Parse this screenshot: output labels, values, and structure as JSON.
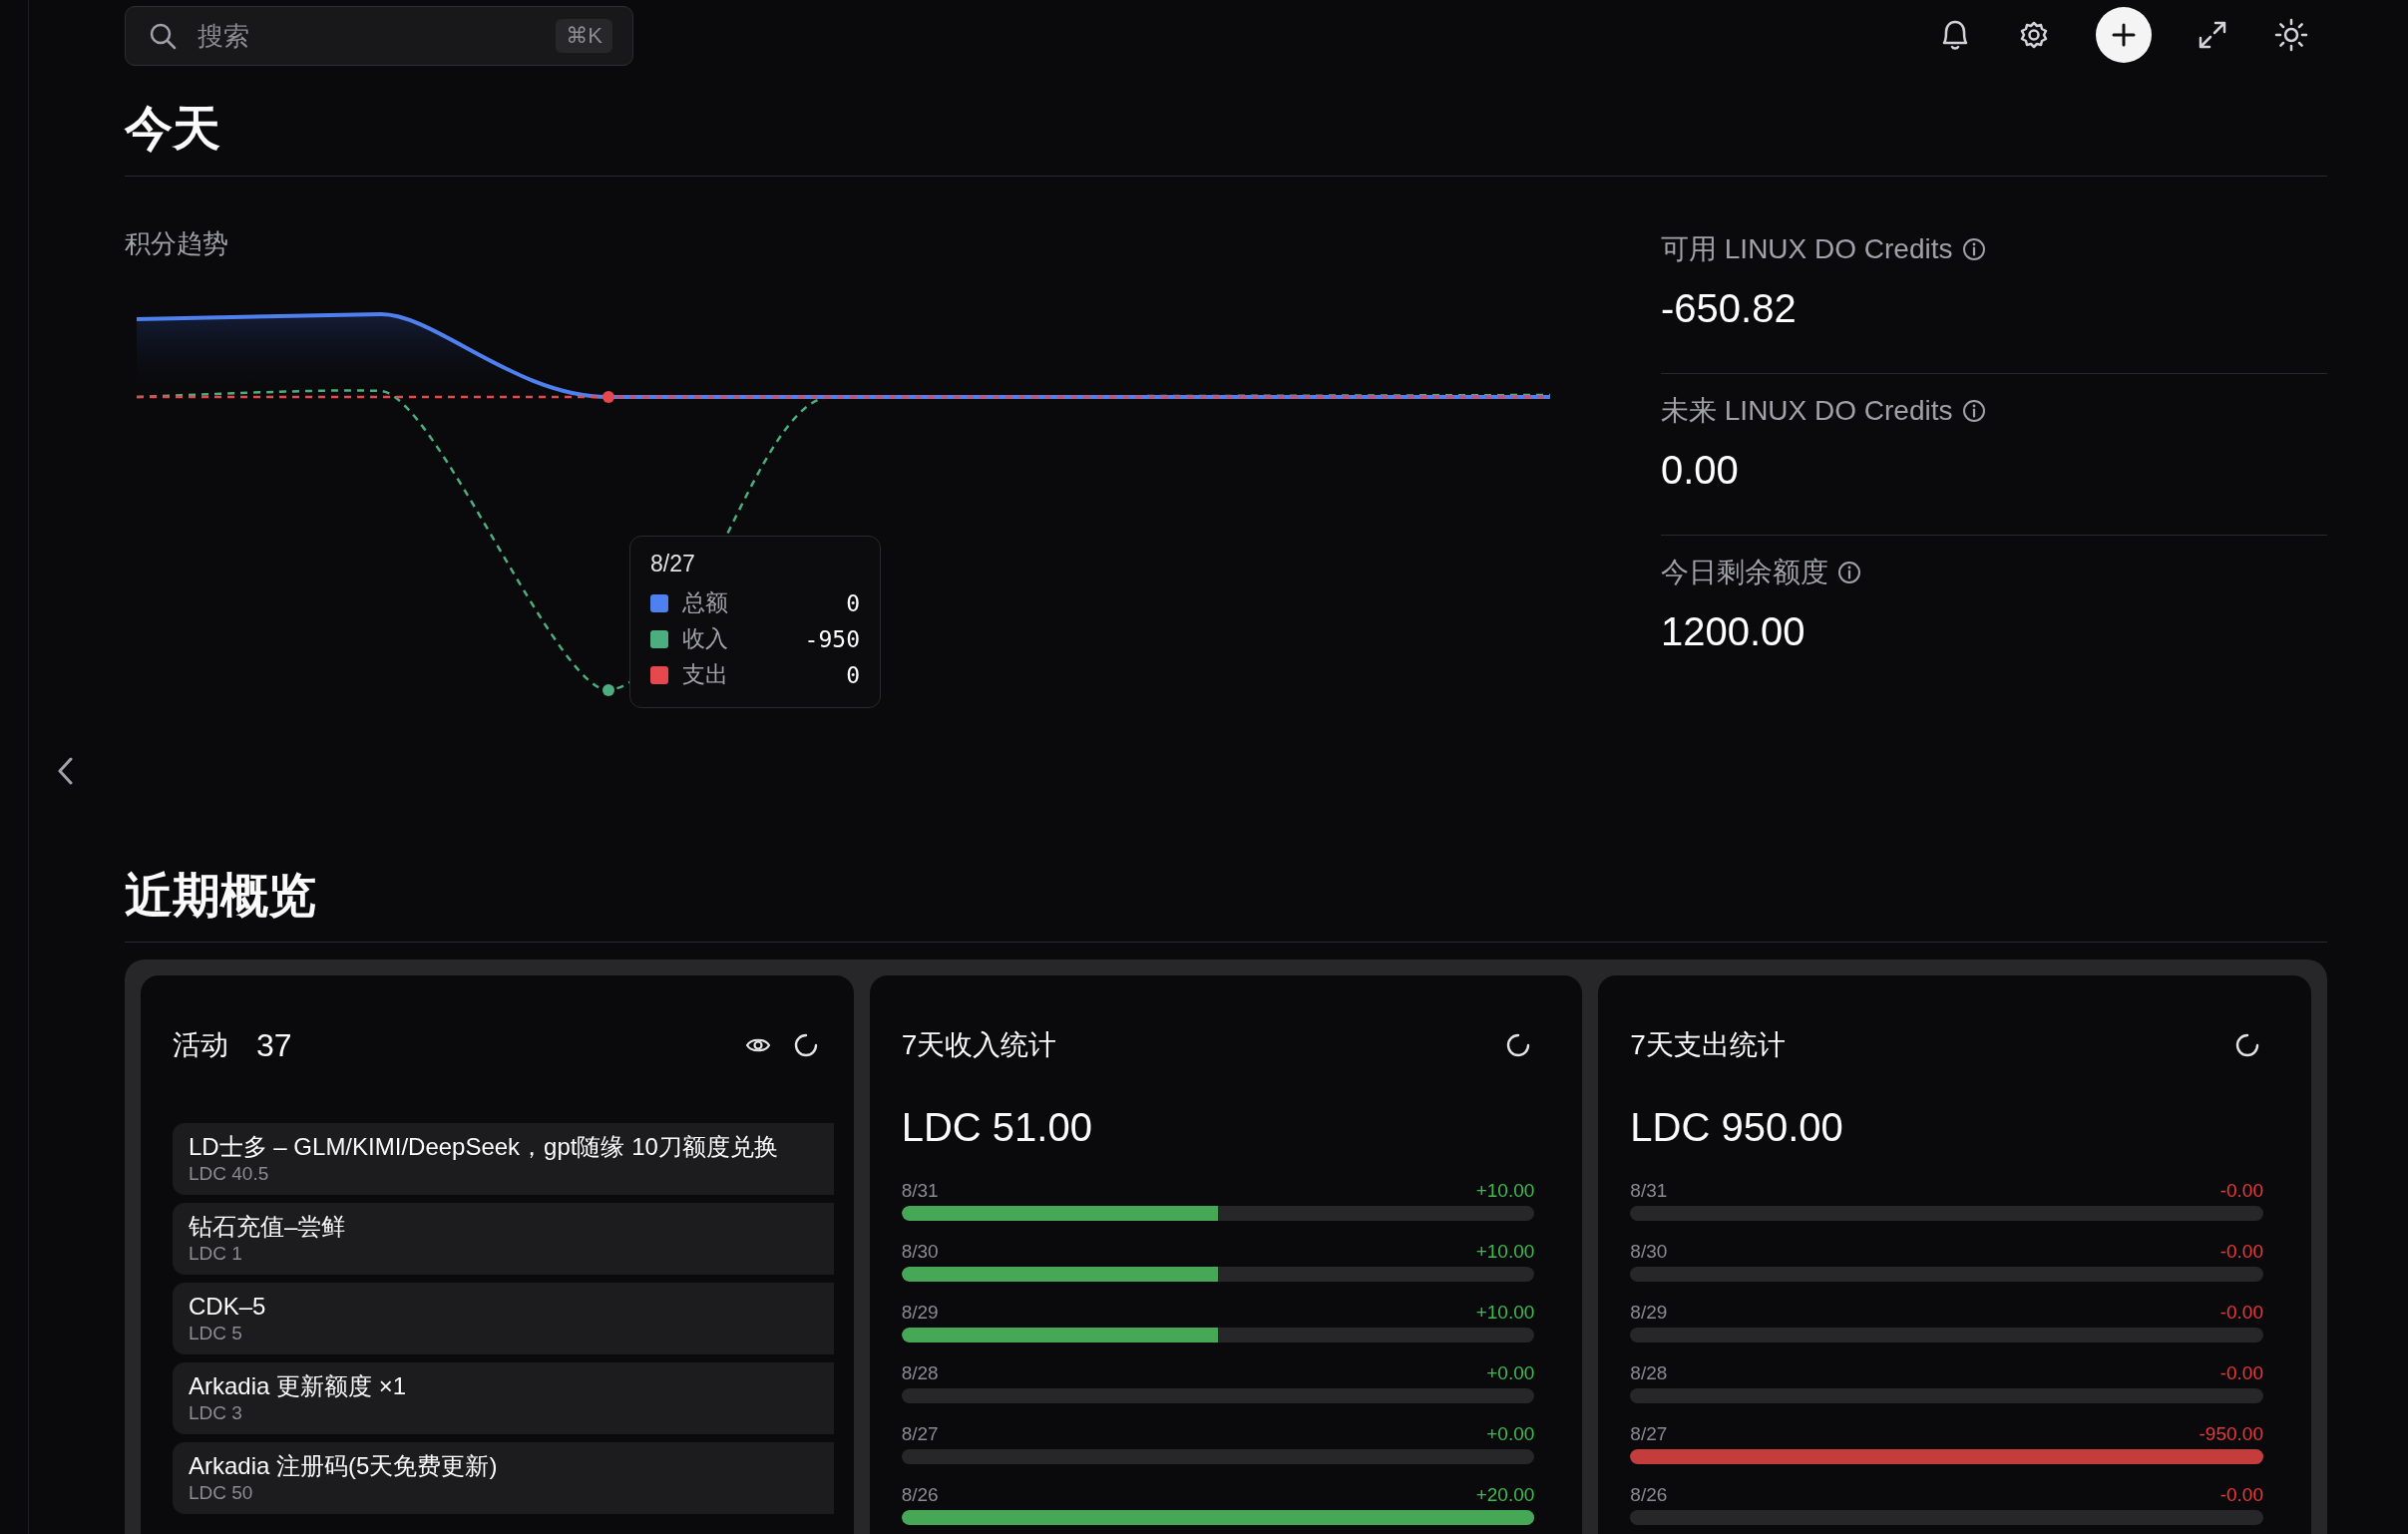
{
  "search": {
    "placeholder": "搜索",
    "shortcut": "⌘K"
  },
  "today": {
    "title": "今天",
    "trend": {
      "title": "积分趋势",
      "tooltip": {
        "date": "8/27",
        "rows": [
          {
            "label": "总额",
            "value": "0",
            "color": "#4f80f0"
          },
          {
            "label": "收入",
            "value": "-950",
            "color": "#4cae7e"
          },
          {
            "label": "支出",
            "value": "0",
            "color": "#e5484d"
          }
        ]
      }
    },
    "stats": [
      {
        "label": "可用 LINUX DO Credits",
        "value": "-650.82"
      },
      {
        "label": "未来 LINUX DO Credits",
        "value": "0.00"
      },
      {
        "label": "今日剩余额度",
        "value": "1200.00"
      }
    ]
  },
  "overview": {
    "title": "近期概览",
    "activity": {
      "title": "活动",
      "count": "37",
      "items": [
        {
          "title": "LD士多 – GLM/KIMI/DeepSeek，gpt随缘 10刀额度兑换",
          "amount": "LDC 40.5"
        },
        {
          "title": "钻石充值–尝鲜",
          "amount": "LDC 1"
        },
        {
          "title": "CDK–5",
          "amount": "LDC 5"
        },
        {
          "title": "Arkadia 更新额度 ×1",
          "amount": "LDC 3"
        },
        {
          "title": "Arkadia 注册码(5天免费更新)",
          "amount": "LDC 50"
        }
      ]
    },
    "cards": [
      {
        "kind": "income",
        "title": "7天收入统计",
        "total": "LDC 51.00",
        "days": [
          {
            "date": "8/31",
            "value": "+10.00",
            "level": 0.5
          },
          {
            "date": "8/30",
            "value": "+10.00",
            "level": 0.5
          },
          {
            "date": "8/29",
            "value": "+10.00",
            "level": 0.5
          },
          {
            "date": "8/28",
            "value": "+0.00"
          },
          {
            "date": "8/27",
            "value": "+0.00"
          },
          {
            "date": "8/26",
            "value": "+20.00",
            "level": 1
          }
        ]
      },
      {
        "kind": "expense",
        "title": "7天支出统计",
        "total": "LDC 950.00",
        "days": [
          {
            "date": "8/31",
            "value": "-0.00"
          },
          {
            "date": "8/30",
            "value": "-0.00"
          },
          {
            "date": "8/29",
            "value": "-0.00"
          },
          {
            "date": "8/28",
            "value": "-0.00"
          },
          {
            "date": "8/27",
            "value": "-950.00",
            "level": 1
          },
          {
            "date": "8/26",
            "value": "-0.00"
          }
        ]
      }
    ]
  }
}
